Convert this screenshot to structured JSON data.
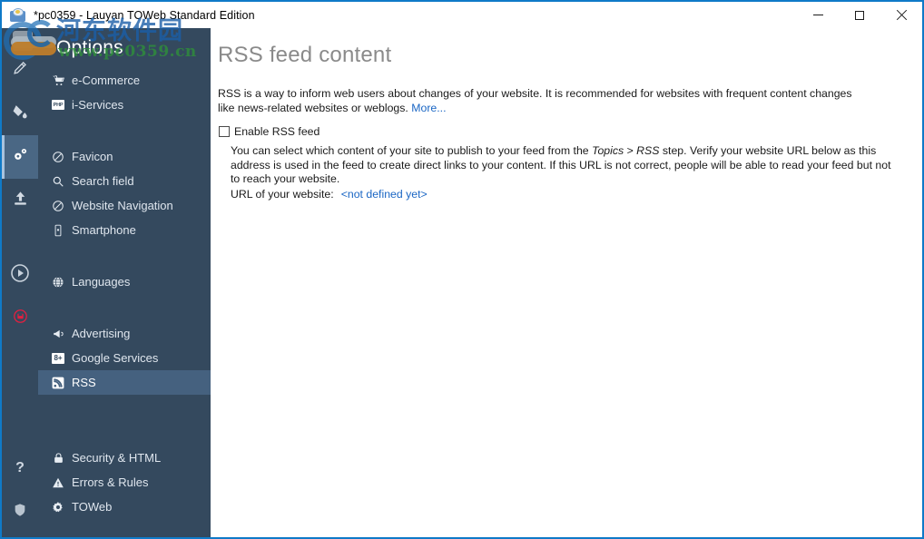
{
  "window": {
    "title": "*pc0359 - Lauyan TOWeb Standard Edition",
    "app_icon": "toweb-app-icon",
    "border_color": "#0f7ac8",
    "controls": {
      "minimize": "minimize-button",
      "maximize": "maximize-button",
      "close": "close-button"
    }
  },
  "rail": {
    "items": [
      {
        "icon": "pencil-icon",
        "name": "edit",
        "selected": false
      },
      {
        "icon": "paint-bucket-icon",
        "name": "theme",
        "selected": false
      },
      {
        "icon": "gears-icon",
        "name": "options",
        "selected": true
      },
      {
        "icon": "upload-icon",
        "name": "publish",
        "selected": false
      },
      {
        "icon": "play-circle-icon",
        "name": "preview",
        "selected": false
      },
      {
        "icon": "save-icon",
        "name": "save",
        "selected": false
      }
    ],
    "bottom_items": [
      {
        "icon": "question-mark-icon",
        "name": "help"
      },
      {
        "icon": "shield-icon",
        "name": "security"
      }
    ],
    "accent_color": "#45617f",
    "save_icon_color": "#e02040"
  },
  "sidebar": {
    "title": "Options",
    "background": "#34495e",
    "active_background": "#45617f",
    "groups": [
      {
        "items": [
          {
            "label": "e-Commerce",
            "icon": "cart-icon",
            "active": false
          },
          {
            "label": "i-Services",
            "icon": "php-icon",
            "active": false
          }
        ]
      },
      {
        "items": [
          {
            "label": "Favicon",
            "icon": "favicon-icon",
            "active": false
          },
          {
            "label": "Search field",
            "icon": "magnifier-icon",
            "active": false
          },
          {
            "label": "Website Navigation",
            "icon": "navigation-icon",
            "active": false
          },
          {
            "label": "Smartphone",
            "icon": "smartphone-icon",
            "active": false
          }
        ]
      },
      {
        "items": [
          {
            "label": "Languages",
            "icon": "globe-icon",
            "active": false
          }
        ]
      },
      {
        "items": [
          {
            "label": "Advertising",
            "icon": "megaphone-icon",
            "active": false
          },
          {
            "label": "Google Services",
            "icon": "google-plus-icon",
            "active": false
          },
          {
            "label": "RSS",
            "icon": "rss-icon",
            "active": true
          }
        ]
      },
      {
        "items": [
          {
            "label": "Security & HTML",
            "icon": "lock-icon",
            "active": false
          },
          {
            "label": "Errors & Rules",
            "icon": "warning-triangle-icon",
            "active": false
          },
          {
            "label": "TOWeb",
            "icon": "gear-icon",
            "active": false
          }
        ]
      }
    ]
  },
  "content": {
    "page_title": "RSS feed content",
    "intro_text": "RSS is a way to inform web users about changes of your website. It is recommended for websites with frequent content changes like news-related websites or weblogs. ",
    "more_link": "More...",
    "checkbox": {
      "label": "Enable RSS feed",
      "checked": false
    },
    "description_part1": "You can select which content of your site to publish to your feed from the ",
    "description_topics": "Topics",
    "description_sep": " > ",
    "description_rss": "RSS",
    "description_part2": " step. Verify your website URL below as this address is used in the feed to create direct links to your content. If this URL is not correct, people will be able to read your feed but not to reach your website.",
    "url_label": "URL of your website:",
    "url_value": "<not defined yet>",
    "link_color": "#1a66c4",
    "title_color": "#8a8a8a"
  },
  "watermark": {
    "chinese_text": "河东软件园",
    "url_text": "www.pc0359.cn",
    "chinese_color": "#1b5fa8",
    "url_color": "#2f8f3a"
  }
}
